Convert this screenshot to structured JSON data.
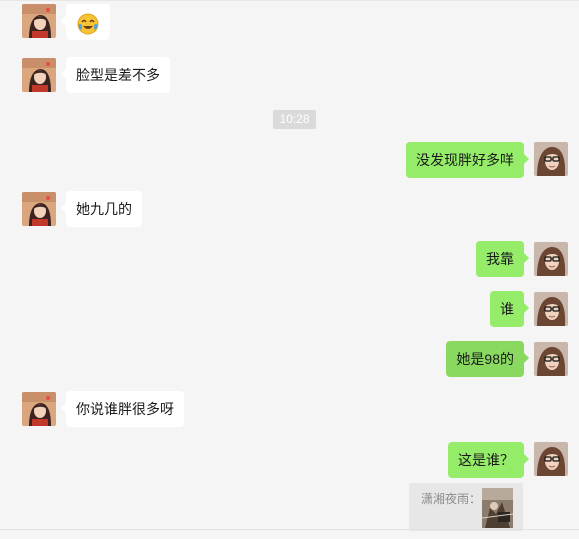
{
  "time_divider": "10:28",
  "messages": [
    {
      "side": "in",
      "content_icon": "tears-of-joy-emoji-icon"
    },
    {
      "side": "in",
      "text": "脸型是差不多"
    },
    {
      "side": "out",
      "text": "没发现胖好多咩"
    },
    {
      "side": "in",
      "text": "她九几的"
    },
    {
      "side": "out",
      "text": "我靠"
    },
    {
      "side": "out",
      "text": "谁"
    },
    {
      "side": "out",
      "text": "她是98的"
    },
    {
      "side": "in",
      "text": "你说谁胖很多呀"
    },
    {
      "side": "out",
      "text": "这是谁？"
    }
  ],
  "quote": {
    "label": "潇湘夜雨：",
    "thumbnail_icon": "image-thumbnail-icon"
  },
  "colors": {
    "background": "#f5f5f5",
    "incoming_bubble": "#ffffff",
    "outgoing_bubble": "#95ec69",
    "outgoing_bubble_selected": "#89d961",
    "time_badge": "#dadada"
  },
  "icons": {
    "contact_avatar": "contact-avatar-icon",
    "self_avatar": "self-avatar-icon"
  }
}
